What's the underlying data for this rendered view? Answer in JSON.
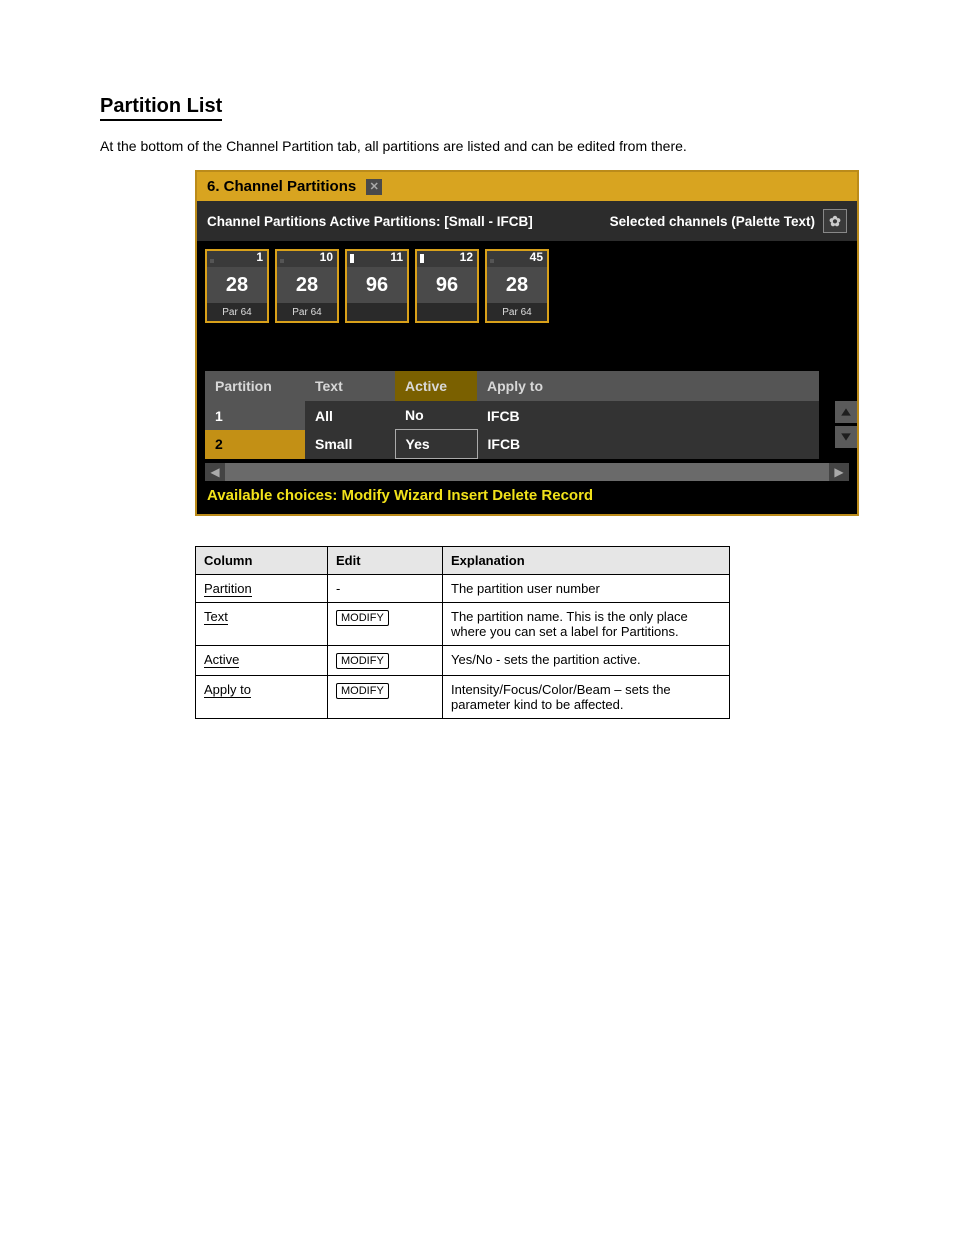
{
  "heading": "Partition List",
  "intro": "At the bottom of the Channel Partition tab, all partitions are listed and can be edited from there.",
  "panel": {
    "tabTitle": "6. Channel Partitions",
    "subLeft": "Channel Partitions   Active Partitions: [Small - IFCB]",
    "subRight": "Selected channels (Palette Text)",
    "channels": [
      {
        "num": "1",
        "val": "28",
        "label": "Par 64",
        "bright": false
      },
      {
        "num": "10",
        "val": "28",
        "label": "Par 64",
        "bright": false
      },
      {
        "num": "11",
        "val": "96",
        "label": "",
        "bright": true
      },
      {
        "num": "12",
        "val": "96",
        "label": "",
        "bright": true
      },
      {
        "num": "45",
        "val": "28",
        "label": "Par 64",
        "bright": false
      }
    ],
    "cols": {
      "partition": "Partition",
      "text": "Text",
      "active": "Active",
      "applyto": "Apply to"
    },
    "rows": [
      {
        "n": "1",
        "text": "All",
        "active": "No",
        "apply": "IFCB",
        "sel": false
      },
      {
        "n": "2",
        "text": "Small",
        "active": "Yes",
        "apply": "IFCB",
        "sel": true
      }
    ],
    "choices": "Available choices: Modify Wizard Insert Delete Record"
  },
  "docTable": {
    "headers": {
      "col": "Column",
      "edit": "Edit",
      "expl": "Explanation"
    },
    "rows": [
      {
        "col": "Partition",
        "edit": "-",
        "expl": "The partition user number"
      },
      {
        "col": "Text",
        "edit": "MODIFY",
        "expl": "The partition name. This is the only place where you can set a label for Partitions."
      },
      {
        "col": "Active",
        "edit": "MODIFY",
        "expl": "Yes/No - sets the partition active."
      },
      {
        "col": "Apply to",
        "edit": "MODIFY",
        "expl": "Intensity/Focus/Color/Beam – sets the parameter kind to be affected."
      }
    ],
    "modifyKey": "MODIFY"
  }
}
